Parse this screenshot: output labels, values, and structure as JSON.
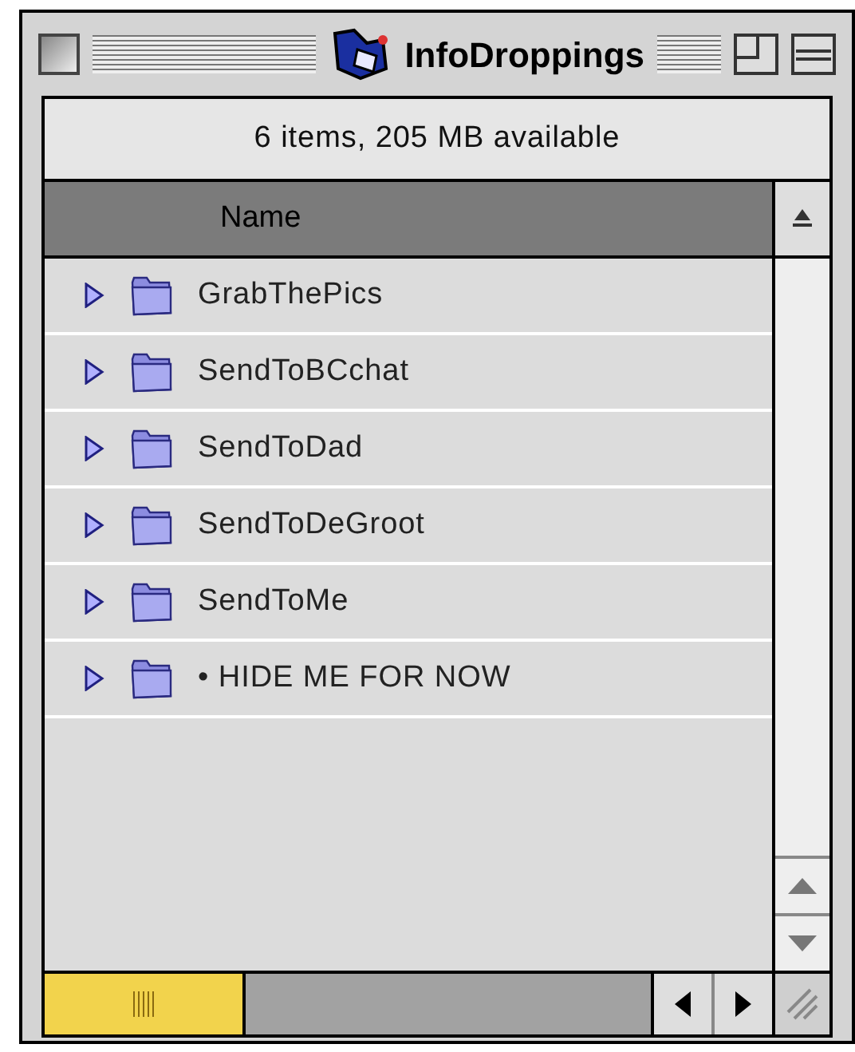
{
  "window": {
    "title": "InfoDroppings"
  },
  "status": "6 items, 205 MB available",
  "columns": [
    {
      "label": "Name",
      "selected": true
    }
  ],
  "rows": [
    {
      "name": "GrabThePics",
      "expanded": false
    },
    {
      "name": "SendToBCchat",
      "expanded": false
    },
    {
      "name": "SendToDad",
      "expanded": false
    },
    {
      "name": "SendToDeGroot",
      "expanded": false
    },
    {
      "name": "SendToMe",
      "expanded": false
    },
    {
      "name": "• HIDE ME FOR NOW",
      "expanded": false
    }
  ]
}
